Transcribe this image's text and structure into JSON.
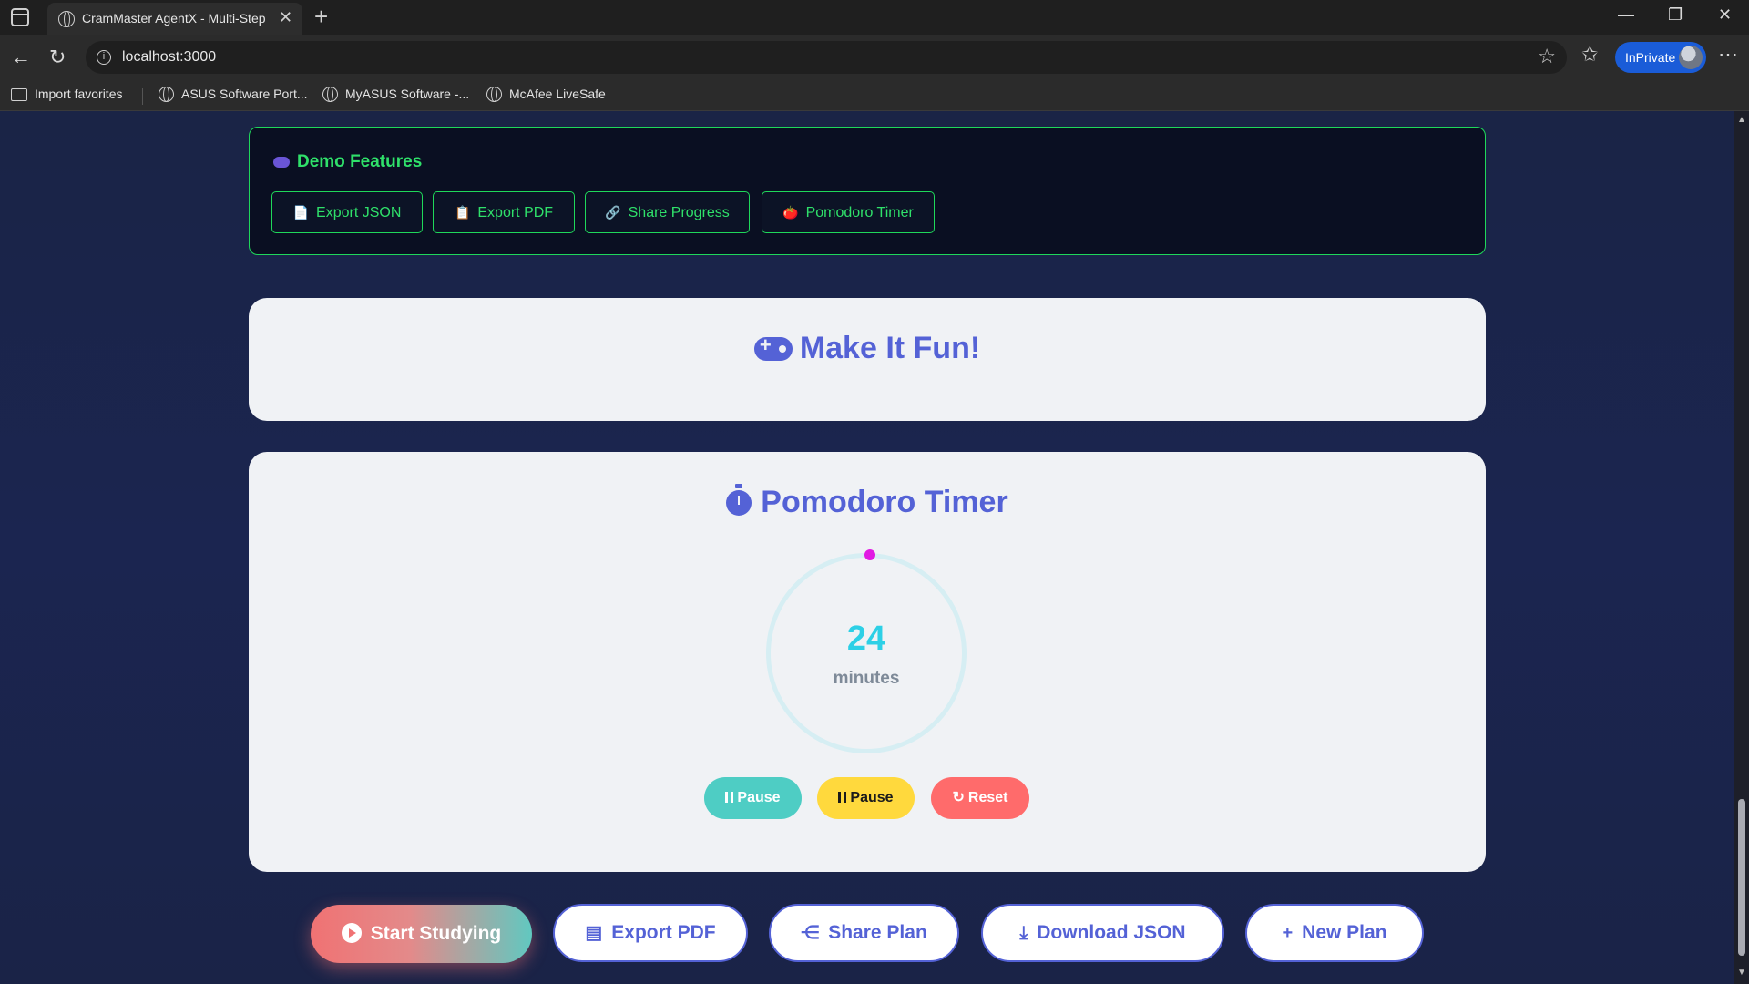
{
  "browser": {
    "tab_title": "CramMaster AgentX - Multi-Step",
    "tab_close": "✕",
    "new_tab": "+",
    "url": "localhost:3000",
    "inprivate_label": "InPrivate",
    "controls": {
      "minimize": "—",
      "restore": "❐",
      "close": "✕"
    },
    "bookmarks": [
      {
        "label": "Import favorites",
        "icon": "folder-import-icon"
      },
      {
        "label": "ASUS Software Port...",
        "icon": "globe-icon"
      },
      {
        "label": "MyASUS Software -...",
        "icon": "globe-icon"
      },
      {
        "label": "McAfee LiveSafe",
        "icon": "globe-icon"
      }
    ]
  },
  "demo_features": {
    "title": "Demo Features",
    "buttons": [
      {
        "label": "Export JSON",
        "icon": "📄"
      },
      {
        "label": "Export PDF",
        "icon": "📋"
      },
      {
        "label": "Share Progress",
        "icon": "🔗"
      },
      {
        "label": "Pomodoro Timer",
        "icon": "🍅"
      }
    ]
  },
  "fun_section": {
    "title": "Make It Fun!",
    "icon": "gamepad-icon"
  },
  "pomodoro": {
    "title": "Pomodoro Timer",
    "icon": "stopwatch-icon",
    "value": "24",
    "unit": "minutes",
    "buttons": [
      {
        "label": "Pause",
        "color": "#4ecdc4"
      },
      {
        "label": "Pause",
        "color": "#ffd93d"
      },
      {
        "label": "Reset",
        "color": "#ff6b6b"
      }
    ],
    "colors": {
      "ring": "#d6eef3",
      "dot": "#e11be3",
      "number": "#2dd0e6"
    }
  },
  "actions": [
    {
      "label": "Start Studying",
      "icon": "play-circle-icon",
      "style": "primary"
    },
    {
      "label": "Export PDF",
      "icon": "file-pdf-icon",
      "style": "outline"
    },
    {
      "label": "Share Plan",
      "icon": "share-icon",
      "style": "outline"
    },
    {
      "label": "Download JSON",
      "icon": "download-icon",
      "style": "outline"
    },
    {
      "label": "New Plan",
      "icon": "plus-icon",
      "style": "outline"
    }
  ],
  "theme": {
    "accent": "#5462d6",
    "demo_green": "#2fe06a",
    "page_bg": "#1b2550",
    "card_bg": "#f0f2f5"
  }
}
